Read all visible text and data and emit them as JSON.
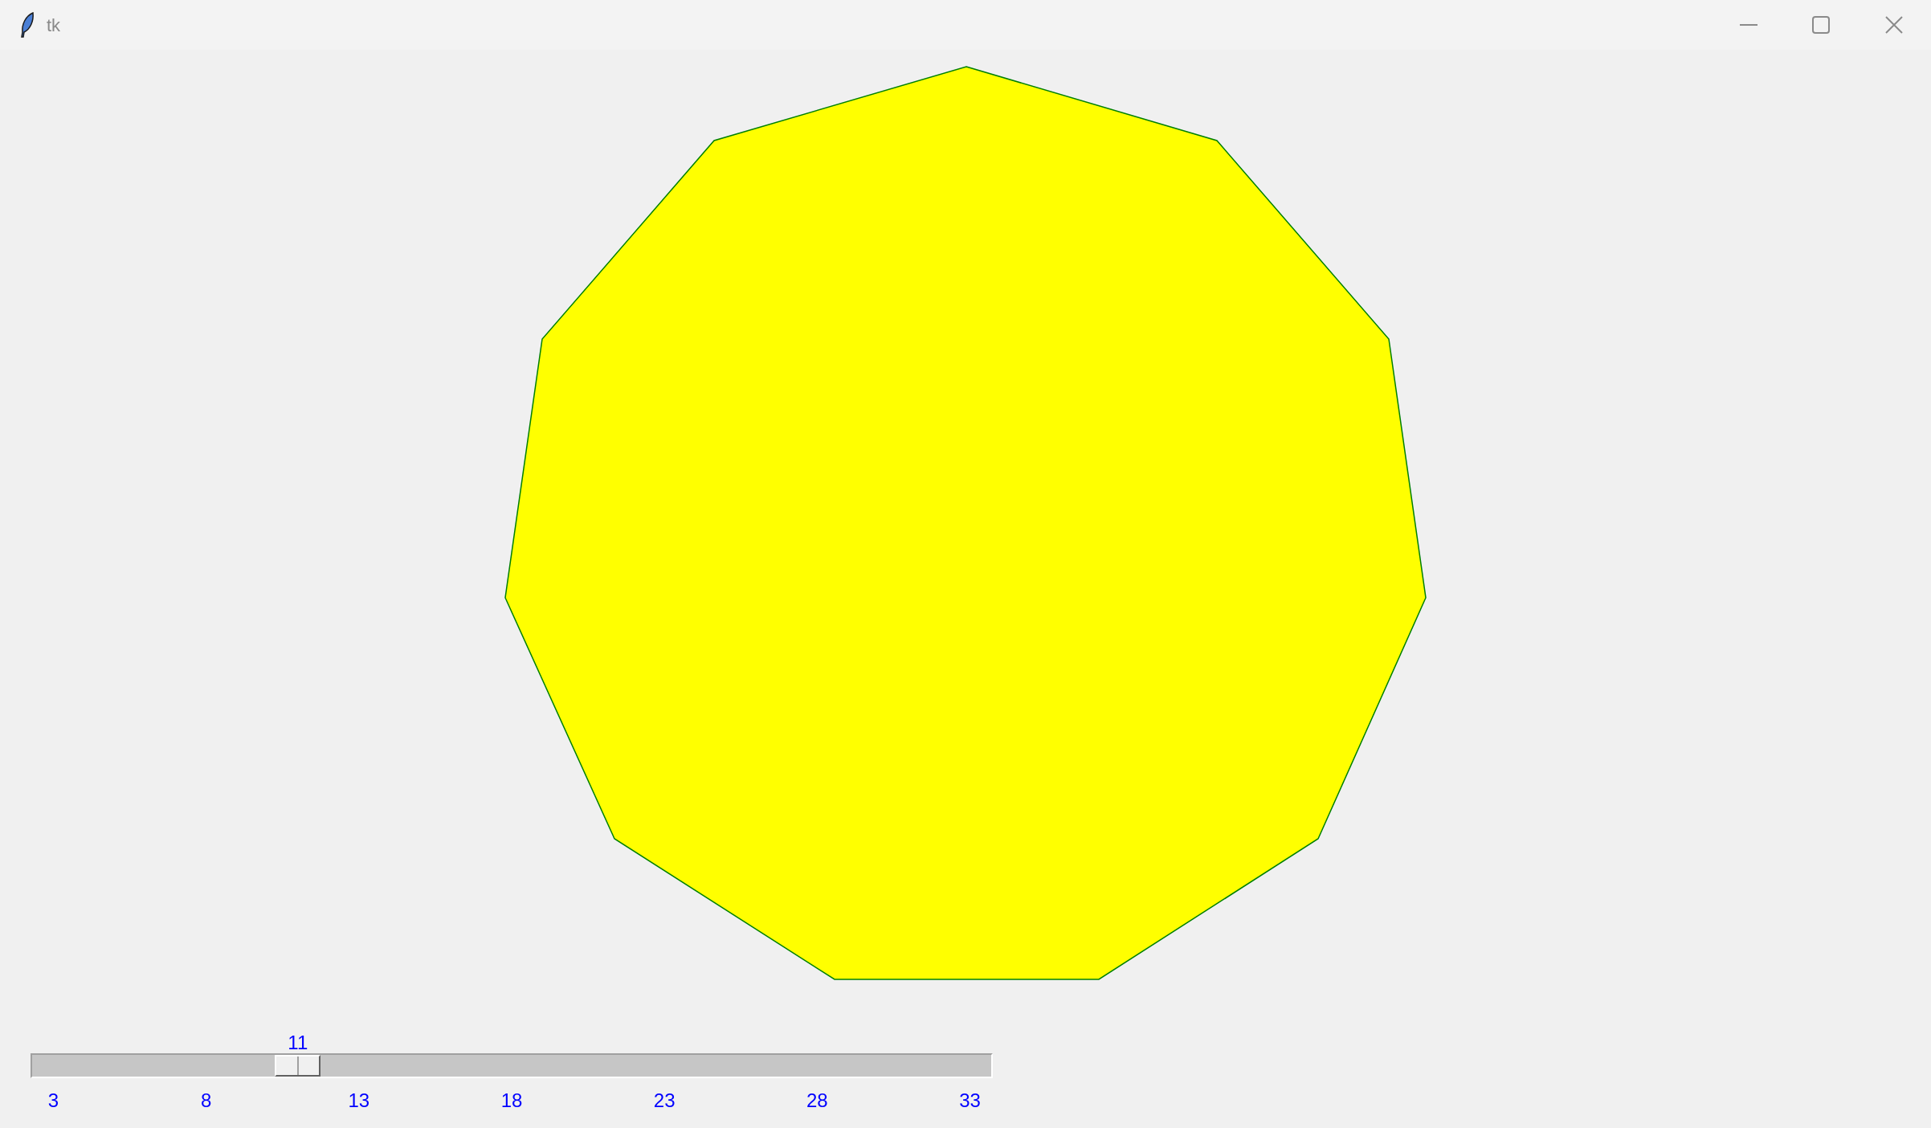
{
  "window": {
    "title": "tk"
  },
  "slider": {
    "value_label": "11",
    "level": 0.2667,
    "ticks": [
      "3",
      "8",
      "13",
      "18",
      "23",
      "28",
      "33"
    ]
  }
}
